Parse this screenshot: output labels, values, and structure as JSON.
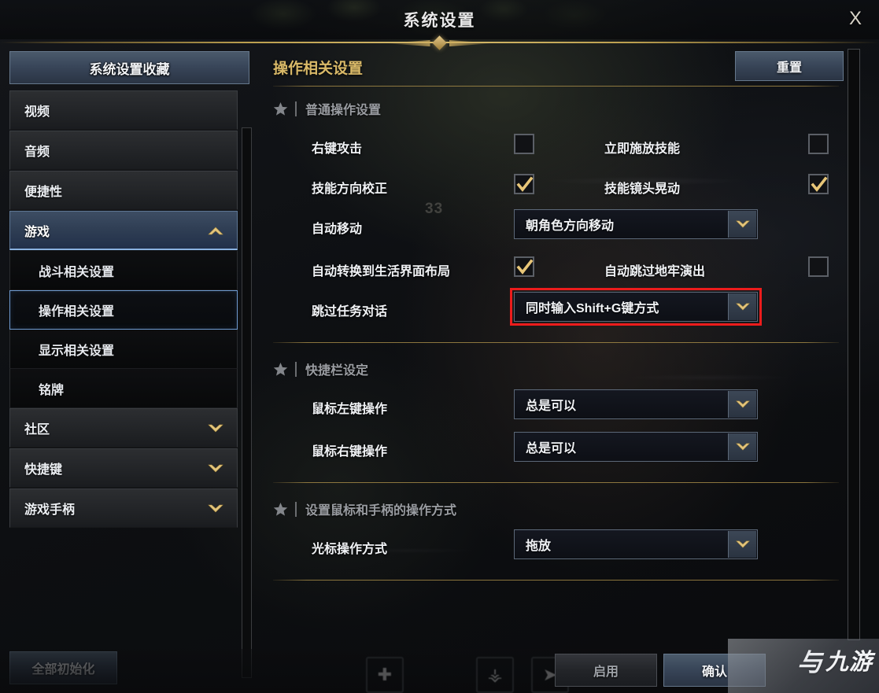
{
  "window": {
    "title": "系统设置",
    "close_label": "X"
  },
  "sidebar": {
    "header_label": "系统设置收藏",
    "items": [
      {
        "label": "视频",
        "type": "top",
        "state": "normal",
        "icon": ""
      },
      {
        "label": "音频",
        "type": "top",
        "state": "normal",
        "icon": ""
      },
      {
        "label": "便捷性",
        "type": "top",
        "state": "normal",
        "icon": ""
      },
      {
        "label": "游戏",
        "type": "top",
        "state": "active",
        "icon": "chevron-up-icon"
      },
      {
        "label": "战斗相关设置",
        "type": "sub",
        "state": "normal",
        "icon": ""
      },
      {
        "label": "操作相关设置",
        "type": "sub",
        "state": "selected",
        "icon": ""
      },
      {
        "label": "显示相关设置",
        "type": "sub",
        "state": "normal",
        "icon": ""
      },
      {
        "label": "铭牌",
        "type": "sub",
        "state": "normal",
        "icon": ""
      },
      {
        "label": "社区",
        "type": "top",
        "state": "normal",
        "icon": "chevron-down-icon"
      },
      {
        "label": "快捷键",
        "type": "top",
        "state": "normal",
        "icon": "chevron-down-icon"
      },
      {
        "label": "游戏手柄",
        "type": "top",
        "state": "normal",
        "icon": "chevron-down-icon"
      }
    ],
    "init_all_label": "全部初始化"
  },
  "main": {
    "title": "操作相关设置",
    "reset_label": "重置",
    "sections": [
      {
        "title": "普通操作设置",
        "rows": [
          {
            "left": {
              "label": "右键攻击",
              "control": "checkbox",
              "checked": false
            },
            "right": {
              "label": "立即施放技能",
              "control": "checkbox",
              "checked": false
            }
          },
          {
            "left": {
              "label": "技能方向校正",
              "control": "checkbox",
              "checked": true
            },
            "right": {
              "label": "技能镜头晃动",
              "control": "checkbox",
              "checked": true
            }
          },
          {
            "left": {
              "label": "自动移动",
              "control": "dropdown",
              "value": "朝角色方向移动"
            },
            "right": null
          },
          {
            "left": {
              "label": "自动转换到生活界面布局",
              "control": "checkbox",
              "checked": true
            },
            "right": {
              "label": "自动跳过地牢演出",
              "control": "checkbox",
              "checked": false
            }
          },
          {
            "left": {
              "label": "跳过任务对话",
              "control": "dropdown",
              "value": "同时输入Shift+G键方式",
              "highlighted": true
            },
            "right": null
          }
        ]
      },
      {
        "title": "快捷栏设定",
        "rows": [
          {
            "left": {
              "label": "鼠标左键操作",
              "control": "dropdown",
              "value": "总是可以"
            },
            "right": null
          },
          {
            "left": {
              "label": "鼠标右键操作",
              "control": "dropdown",
              "value": "总是可以"
            },
            "right": null
          }
        ]
      },
      {
        "title": "设置鼠标和手柄的操作方式",
        "rows": [
          {
            "left": {
              "label": "光标操作方式",
              "control": "dropdown",
              "value": "拖放"
            },
            "right": null
          }
        ]
      }
    ]
  },
  "footer": {
    "apply_label": "启用",
    "confirm_label": "确认"
  },
  "hud": {
    "number_overlay": "33",
    "slots": [
      {
        "name": "plus-slot",
        "glyph": "✚"
      },
      {
        "name": "trident-slot",
        "glyph": "⚶"
      },
      {
        "name": "compass-slot",
        "glyph": "➤"
      }
    ]
  },
  "watermark": {
    "mark": "与",
    "text": "九游"
  },
  "colors": {
    "accent_gold": "#d9b968",
    "highlight_red": "#ec1c1c",
    "panel_blue": "#394659",
    "selected_border": "#6f9ad0"
  }
}
